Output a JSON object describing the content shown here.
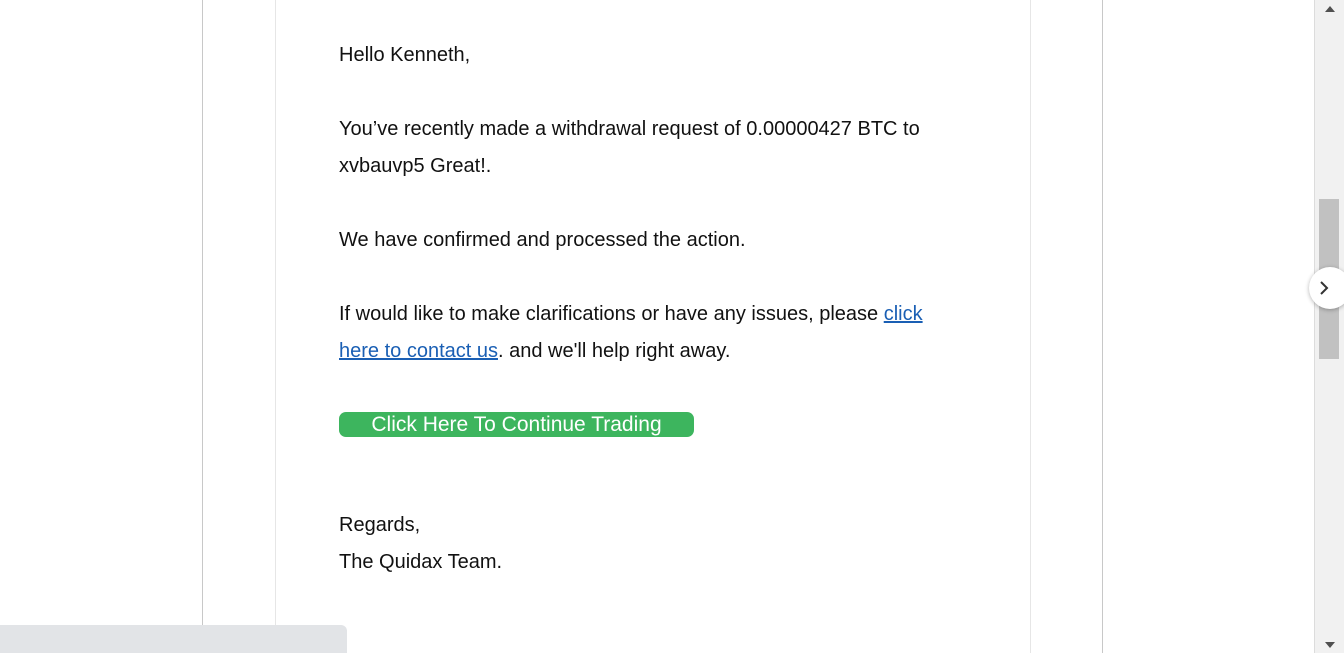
{
  "email": {
    "greeting": "Hello Kenneth,",
    "withdrawal_text": "You’ve recently made a withdrawal request of 0.00000427 BTC to xvbauvp5 Great!.",
    "confirmation_text": "We have confirmed and processed the action.",
    "clarification_prefix": "If would like to make clarifications or have any issues, please ",
    "contact_link": "click here to contact us",
    "clarification_suffix": ". and we'll help right away.",
    "cta_label": "Click Here To Continue Trading",
    "signoff_regards": "Regards,",
    "signoff_team": "The Quidax Team."
  },
  "colors": {
    "cta_background": "#3db55e",
    "link": "#1a5fb4",
    "text": "#111111"
  },
  "icons": {
    "scroll_up": "triangle-up-icon",
    "scroll_down": "triangle-down-icon",
    "side_toggle": "chevron-right-icon"
  }
}
